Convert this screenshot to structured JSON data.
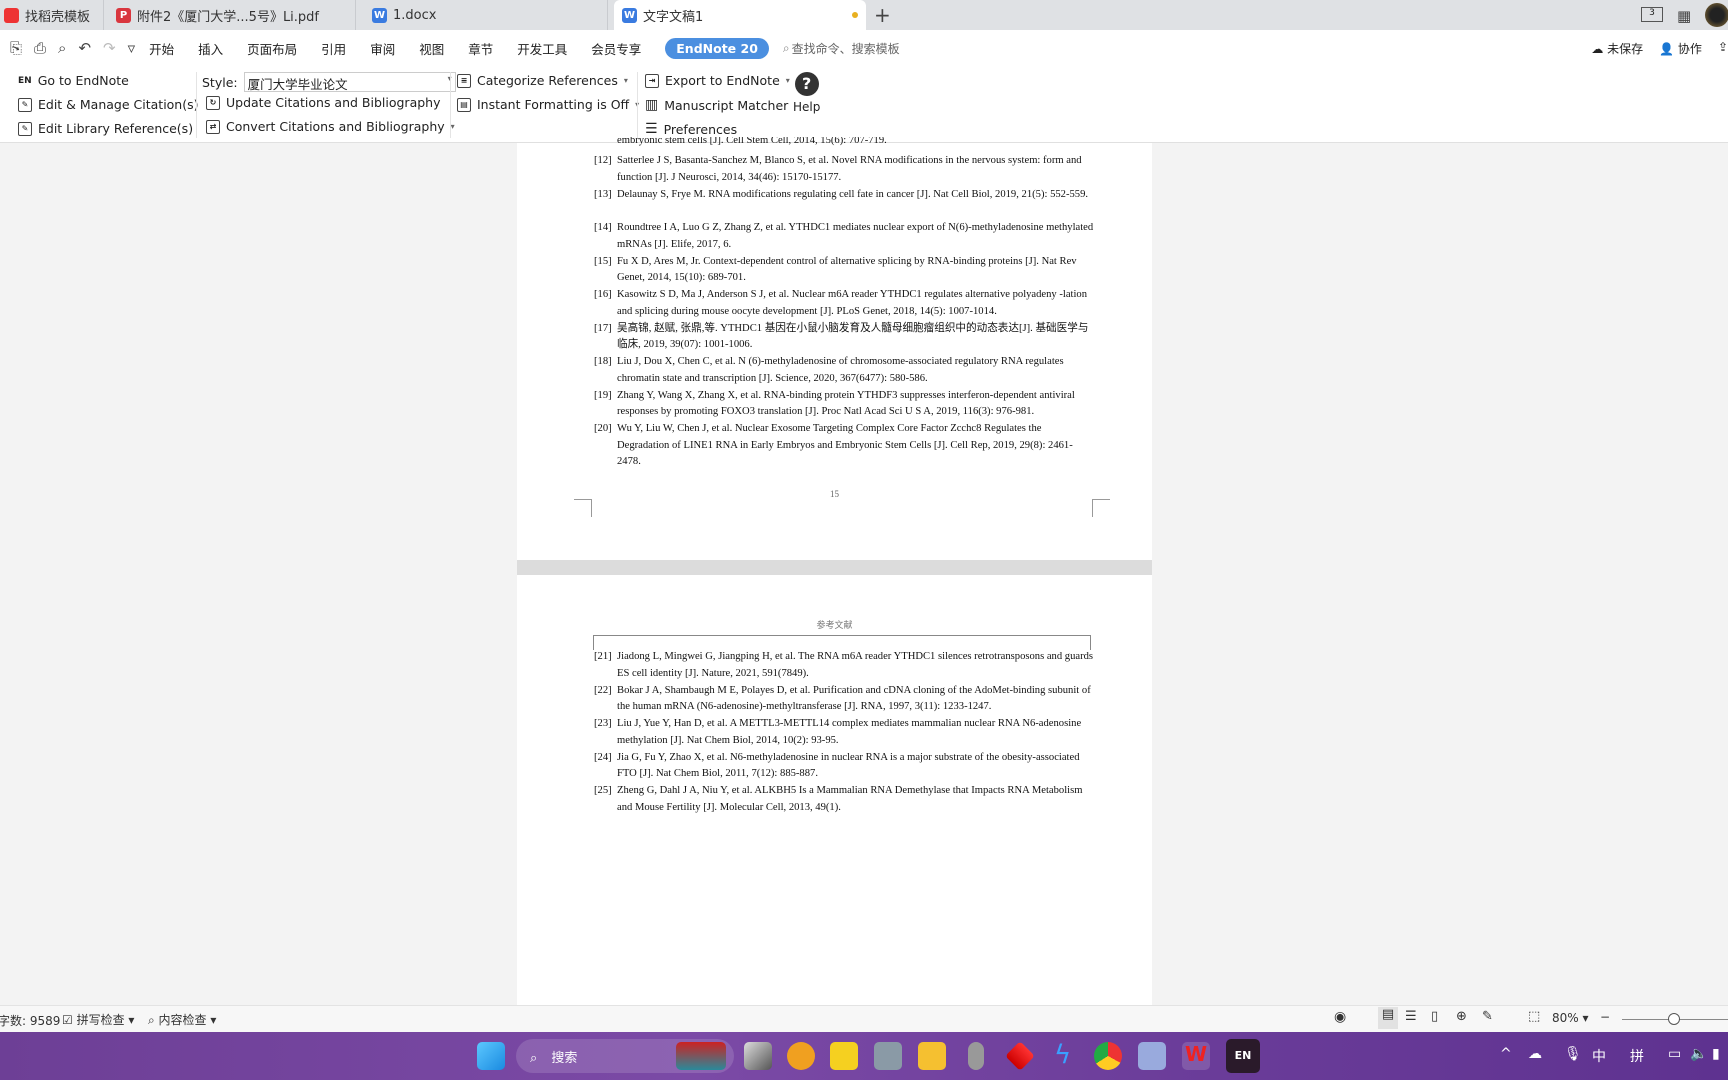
{
  "tabs": [
    {
      "label": "找稻壳模板",
      "icon": "docer-icon"
    },
    {
      "label": "附件2《厦门大学...5号》Li.pdf",
      "icon": "pdf-icon"
    },
    {
      "label": "1.docx",
      "icon": "word-icon"
    },
    {
      "label": "文字文稿1",
      "icon": "word-icon",
      "active": true
    }
  ],
  "top_right": {
    "window_count": "3"
  },
  "menu": [
    "开始",
    "插入",
    "页面布局",
    "引用",
    "审阅",
    "视图",
    "章节",
    "开发工具",
    "会员专享"
  ],
  "endnote_tab": "EndNote 20",
  "search_placeholder": "查找命令、搜索模板",
  "save_status": "未保存",
  "collab": "协作",
  "ribbon": {
    "go": "Go to EndNote",
    "edit_manage": "Edit & Manage Citation(s)",
    "edit_library": "Edit Library Reference(s)",
    "style_label": "Style:",
    "style_value": "厦门大学毕业论文",
    "update": "Update Citations and Bibliography",
    "convert": "Convert Citations and Bibliography",
    "categorize": "Categorize References",
    "instant": "Instant Formatting is Off",
    "export": "Export to EndNote",
    "matcher": "Manuscript Matcher",
    "prefs": "Preferences",
    "help": "Help"
  },
  "page1": {
    "partial_line": "embryonic stem cells [J]. Cell Stem Cell, 2014, 15(6): 707-719.",
    "page_number": "15",
    "refs": [
      {
        "n": "[12]",
        "t": "Satterlee J S, Basanta-Sanchez M, Blanco S, et al. Novel RNA modifications in the nervous system: form and function [J]. J Neurosci, 2014, 34(46): 15170-15177."
      },
      {
        "n": "[13]",
        "t": "Delaunay S, Frye M. RNA modifications regulating cell fate in cancer [J]. Nat Cell Biol, 2019, 21(5): 552-559."
      },
      {
        "n": "[14]",
        "t": "Roundtree I A, Luo G Z, Zhang Z, et al. YTHDC1 mediates nuclear export of N(6)-methyladenosine methylated mRNAs [J]. Elife, 2017, 6."
      },
      {
        "n": "[15]",
        "t": "Fu X D, Ares M, Jr. Context-dependent control of alternative splicing by RNA-binding proteins [J]. Nat Rev Genet, 2014, 15(10): 689-701."
      },
      {
        "n": "[16]",
        "t": "Kasowitz S D, Ma J, Anderson S J, et al. Nuclear m6A reader YTHDC1 regulates alternative polyadeny -lation and splicing during mouse oocyte development [J]. PLoS Genet, 2018, 14(5): 1007-1014."
      },
      {
        "n": "[17]",
        "t": "吴高锦, 赵赋, 张鼎,等. YTHDC1 基因在小鼠小脑发育及人髓母细胞瘤组织中的动态表达[J]. 基础医学与临床, 2019, 39(07): 1001-1006."
      },
      {
        "n": "[18]",
        "t": "Liu J, Dou X, Chen C, et al. N (6)-methyladenosine of chromosome-associated regulatory RNA regulates chromatin state and transcription [J]. Science, 2020, 367(6477): 580-586."
      },
      {
        "n": "[19]",
        "t": "Zhang Y, Wang X, Zhang X, et al. RNA-binding protein YTHDF3 suppresses interferon-dependent antiviral responses by promoting FOXO3 translation [J]. Proc Natl Acad Sci U S A, 2019, 116(3): 976-981."
      },
      {
        "n": "[20]",
        "t": "Wu Y, Liu W, Chen J, et al. Nuclear Exosome Targeting Complex Core Factor Zcchc8 Regulates the Degradation of LINE1 RNA in Early Embryos and Embryonic Stem Cells [J]. Cell Rep, 2019, 29(8): 2461-2478."
      }
    ]
  },
  "page2": {
    "header": "参考文献",
    "refs": [
      {
        "n": "[21]",
        "t": "Jiadong L, Mingwei G, Jiangping H, et al. The RNA m6A reader YTHDC1 silences retrotransposons and guards ES cell identity [J]. Nature, 2021, 591(7849)."
      },
      {
        "n": "[22]",
        "t": "Bokar J A, Shambaugh M E, Polayes D, et al. Purification and cDNA cloning of the AdoMet-binding subunit of the human mRNA (N6-adenosine)-methyltransferase [J]. RNA, 1997, 3(11): 1233-1247."
      },
      {
        "n": "[23]",
        "t": "Liu J, Yue Y, Han D, et al. A METTL3-METTL14 complex mediates mammalian nuclear RNA N6-adenosine methylation [J]. Nat Chem Biol, 2014, 10(2): 93-95."
      },
      {
        "n": "[24]",
        "t": "Jia G, Fu Y, Zhao X, et al. N6-methyladenosine in nuclear RNA is a major substrate of the obesity-associated FTO [J]. Nat Chem Biol, 2011, 7(12): 885-887."
      },
      {
        "n": "[25]",
        "t": "Zheng G, Dahl J A, Niu Y, et al. ALKBH5 Is a Mammalian RNA Demethylase that Impacts RNA Metabolism and Mouse Fertility [J]. Molecular Cell, 2013, 49(1)."
      }
    ]
  },
  "status": {
    "word_count": "字数: 9589",
    "spell": "拼写检查",
    "content": "内容检查",
    "zoom": "80%"
  },
  "taskbar": {
    "search": "搜索",
    "ime1": "中",
    "ime2": "拼",
    "endnote_icon": "EN"
  }
}
